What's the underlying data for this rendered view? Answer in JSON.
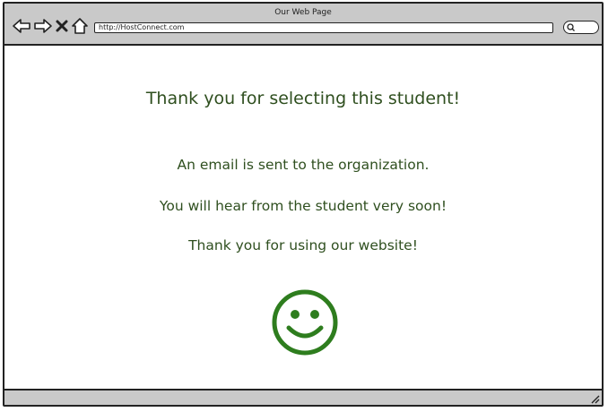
{
  "browser": {
    "window_title": "Our Web Page",
    "url": "http://HostConnect.com",
    "nav_icons": [
      "back-arrow-icon",
      "forward-arrow-icon",
      "close-icon",
      "home-icon"
    ],
    "search_icon": "search-icon"
  },
  "page": {
    "heading": "Thank you for selecting this student!",
    "lines": [
      "An email is sent to the organization.",
      "You will hear from the student very soon!",
      "Thank you for using our website!"
    ],
    "icon": "smiley-face-icon",
    "text_color": "#2f4f1f",
    "icon_color": "#2e7d1e"
  },
  "colors": {
    "chrome": "#c9c9c9",
    "border": "#222222",
    "background": "#ffffff"
  }
}
